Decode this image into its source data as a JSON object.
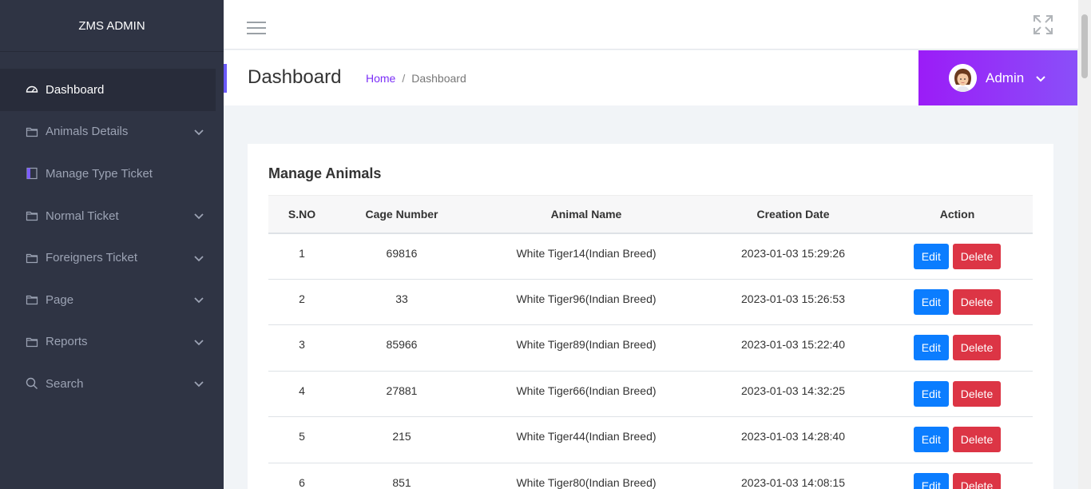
{
  "brand": "ZMS ADMIN",
  "sidebar": {
    "items": [
      {
        "label": "Dashboard",
        "icon": "dashboard-gauge-icon",
        "active": true,
        "expandable": false
      },
      {
        "label": "Animals Details",
        "icon": "folder-icon",
        "expandable": true
      },
      {
        "label": "Manage Type Ticket",
        "icon": "book-icon",
        "expandable": false
      },
      {
        "label": "Normal Ticket",
        "icon": "folder-icon",
        "expandable": true
      },
      {
        "label": "Foreigners Ticket",
        "icon": "folder-icon",
        "expandable": true
      },
      {
        "label": "Page",
        "icon": "folder-icon",
        "expandable": true
      },
      {
        "label": "Reports",
        "icon": "folder-icon",
        "expandable": true
      },
      {
        "label": "Search",
        "icon": "search-icon",
        "expandable": true
      }
    ]
  },
  "header": {
    "title": "Dashboard",
    "breadcrumb": {
      "home": "Home",
      "separator": "/",
      "current": "Dashboard"
    },
    "user": {
      "name": "Admin"
    }
  },
  "card": {
    "title": "Manage Animals",
    "columns": [
      "S.NO",
      "Cage Number",
      "Animal Name",
      "Creation Date",
      "Action"
    ],
    "rows": [
      {
        "sno": "1",
        "cage": "69816",
        "name": "White Tiger14(Indian Breed)",
        "date": "2023-01-03 15:29:26"
      },
      {
        "sno": "2",
        "cage": "33",
        "name": "White Tiger96(Indian Breed)",
        "date": "2023-01-03 15:26:53"
      },
      {
        "sno": "3",
        "cage": "85966",
        "name": "White Tiger89(Indian Breed)",
        "date": "2023-01-03 15:22:40"
      },
      {
        "sno": "4",
        "cage": "27881",
        "name": "White Tiger66(Indian Breed)",
        "date": "2023-01-03 14:32:25"
      },
      {
        "sno": "5",
        "cage": "215",
        "name": "White Tiger44(Indian Breed)",
        "date": "2023-01-03 14:28:40"
      },
      {
        "sno": "6",
        "cage": "851",
        "name": "White Tiger80(Indian Breed)",
        "date": "2023-01-03 14:08:15"
      }
    ],
    "edit_label": "Edit",
    "delete_label": "Delete"
  },
  "colors": {
    "sidebar_bg": "#2f3444",
    "accent_purple": "#9b1cf7",
    "edit_blue": "#0b7dff",
    "delete_red": "#dc3545",
    "link_purple": "#7b2ff7"
  }
}
